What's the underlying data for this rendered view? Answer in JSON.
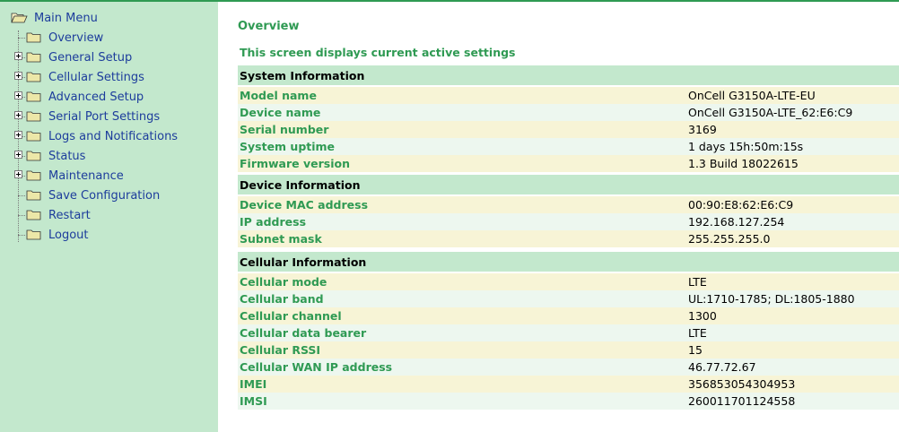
{
  "sidebar": {
    "items": [
      {
        "label": "Main Menu",
        "expandable": false,
        "open": true
      },
      {
        "label": "Overview",
        "expandable": false
      },
      {
        "label": "General Setup",
        "expandable": true
      },
      {
        "label": "Cellular Settings",
        "expandable": true
      },
      {
        "label": "Advanced Setup",
        "expandable": true
      },
      {
        "label": "Serial Port Settings",
        "expandable": true
      },
      {
        "label": "Logs and Notifications",
        "expandable": true
      },
      {
        "label": "Status",
        "expandable": true
      },
      {
        "label": "Maintenance",
        "expandable": true
      },
      {
        "label": "Save Configuration",
        "expandable": false
      },
      {
        "label": "Restart",
        "expandable": false
      },
      {
        "label": "Logout",
        "expandable": false
      }
    ]
  },
  "main": {
    "title": "Overview",
    "description": "This screen displays current active settings",
    "sections": [
      {
        "title": "System Information",
        "rows": [
          {
            "label": "Model name",
            "value": "OnCell G3150A-LTE-EU"
          },
          {
            "label": "Device name",
            "value": "OnCell G3150A-LTE_62:E6:C9"
          },
          {
            "label": "Serial number",
            "value": "3169"
          },
          {
            "label": "System uptime",
            "value": "1 days 15h:50m:15s"
          },
          {
            "label": "Firmware version",
            "value": "1.3 Build 18022615"
          }
        ]
      },
      {
        "title": "Device Information",
        "rows": [
          {
            "label": "Device MAC address",
            "value": "00:90:E8:62:E6:C9"
          },
          {
            "label": "IP address",
            "value": "192.168.127.254"
          },
          {
            "label": "Subnet mask",
            "value": "255.255.255.0"
          }
        ]
      },
      {
        "title": "Cellular Information",
        "rows": [
          {
            "label": "Cellular mode",
            "value": "LTE"
          },
          {
            "label": "Cellular band",
            "value": "UL:1710-1785; DL:1805-1880"
          },
          {
            "label": "Cellular channel",
            "value": "1300"
          },
          {
            "label": "Cellular data bearer",
            "value": "LTE"
          },
          {
            "label": "Cellular RSSI",
            "value": "15"
          },
          {
            "label": "Cellular WAN IP address",
            "value": "46.77.72.67"
          },
          {
            "label": "IMEI",
            "value": "356853054304953"
          },
          {
            "label": "IMSI",
            "value": "260011701124558"
          }
        ]
      }
    ]
  },
  "colors": {
    "accent": "#2f9a53",
    "sidebar_bg": "#c3e8cd",
    "link": "#1d3d9c",
    "row_odd": "#f7f4d6",
    "row_even": "#edf7ef"
  }
}
